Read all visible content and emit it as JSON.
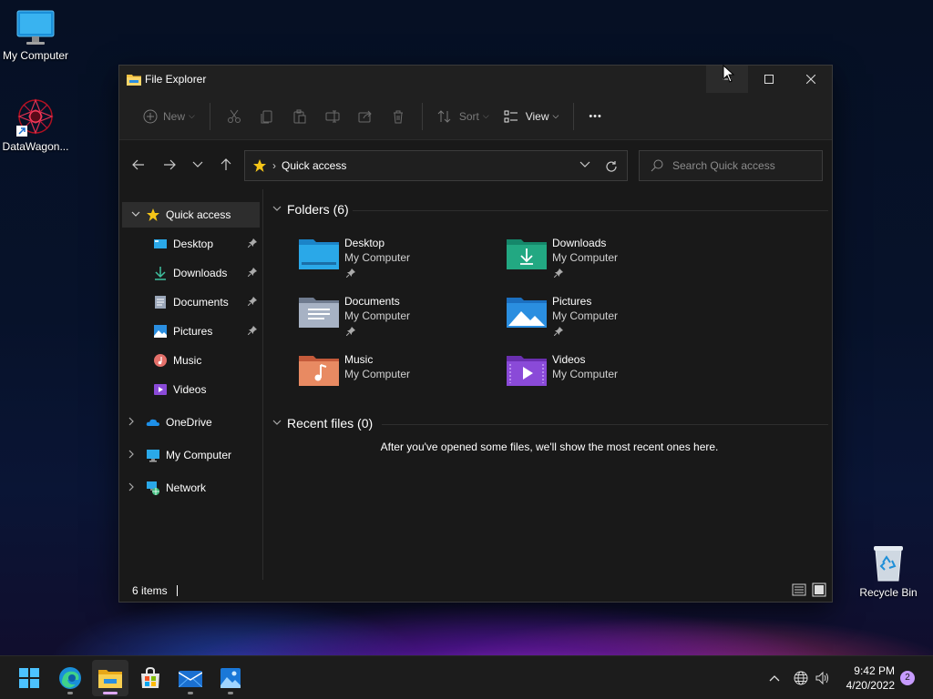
{
  "desktop": {
    "icons": [
      {
        "label": "My Computer",
        "icon": "monitor-icon"
      },
      {
        "label": "DataWagon...",
        "icon": "datawagon-shortcut-icon"
      },
      {
        "label": "Recycle Bin",
        "icon": "recycle-bin-icon"
      }
    ]
  },
  "explorer": {
    "title": "File Explorer",
    "toolbar": {
      "new_label": "New",
      "sort_label": "Sort",
      "view_label": "View",
      "more_label": "•••"
    },
    "address": {
      "crumb": "Quick access"
    },
    "search": {
      "placeholder": "Search Quick access"
    },
    "sidebar": {
      "items": [
        {
          "label": "Quick access",
          "icon": "star-icon"
        },
        {
          "label": "Desktop",
          "icon": "desktop-icon",
          "pinned": true
        },
        {
          "label": "Downloads",
          "icon": "download-icon",
          "pinned": true
        },
        {
          "label": "Documents",
          "icon": "document-icon",
          "pinned": true
        },
        {
          "label": "Pictures",
          "icon": "picture-icon",
          "pinned": true
        },
        {
          "label": "Music",
          "icon": "music-icon"
        },
        {
          "label": "Videos",
          "icon": "video-icon"
        },
        {
          "label": "OneDrive",
          "icon": "cloud-icon"
        },
        {
          "label": "My Computer",
          "icon": "monitor-icon"
        },
        {
          "label": "Network",
          "icon": "network-icon"
        }
      ]
    },
    "folders_header": "Folders (6)",
    "folders": [
      {
        "name": "Desktop",
        "location": "My Computer",
        "pinned": true,
        "color": "#2aa8e8"
      },
      {
        "name": "Downloads",
        "location": "My Computer",
        "pinned": true,
        "color": "#22a882"
      },
      {
        "name": "Documents",
        "location": "My Computer",
        "pinned": true,
        "color": "#8e9bb0"
      },
      {
        "name": "Pictures",
        "location": "My Computer",
        "pinned": true,
        "color": "#2a8ee0"
      },
      {
        "name": "Music",
        "location": "My Computer",
        "pinned": false,
        "color": "#e4706a"
      },
      {
        "name": "Videos",
        "location": "My Computer",
        "pinned": false,
        "color": "#8a4ad8"
      }
    ],
    "recent_header": "Recent files (0)",
    "recent_empty": "After you've opened some files, we'll show the most recent ones here.",
    "status": {
      "items": "6 items"
    }
  },
  "taskbar": {
    "apps": [
      "start-icon",
      "edge-icon",
      "file-explorer-icon",
      "store-icon",
      "mail-icon",
      "photos-icon"
    ],
    "time": "9:42 PM",
    "date": "4/20/2022",
    "notifications": "2"
  }
}
